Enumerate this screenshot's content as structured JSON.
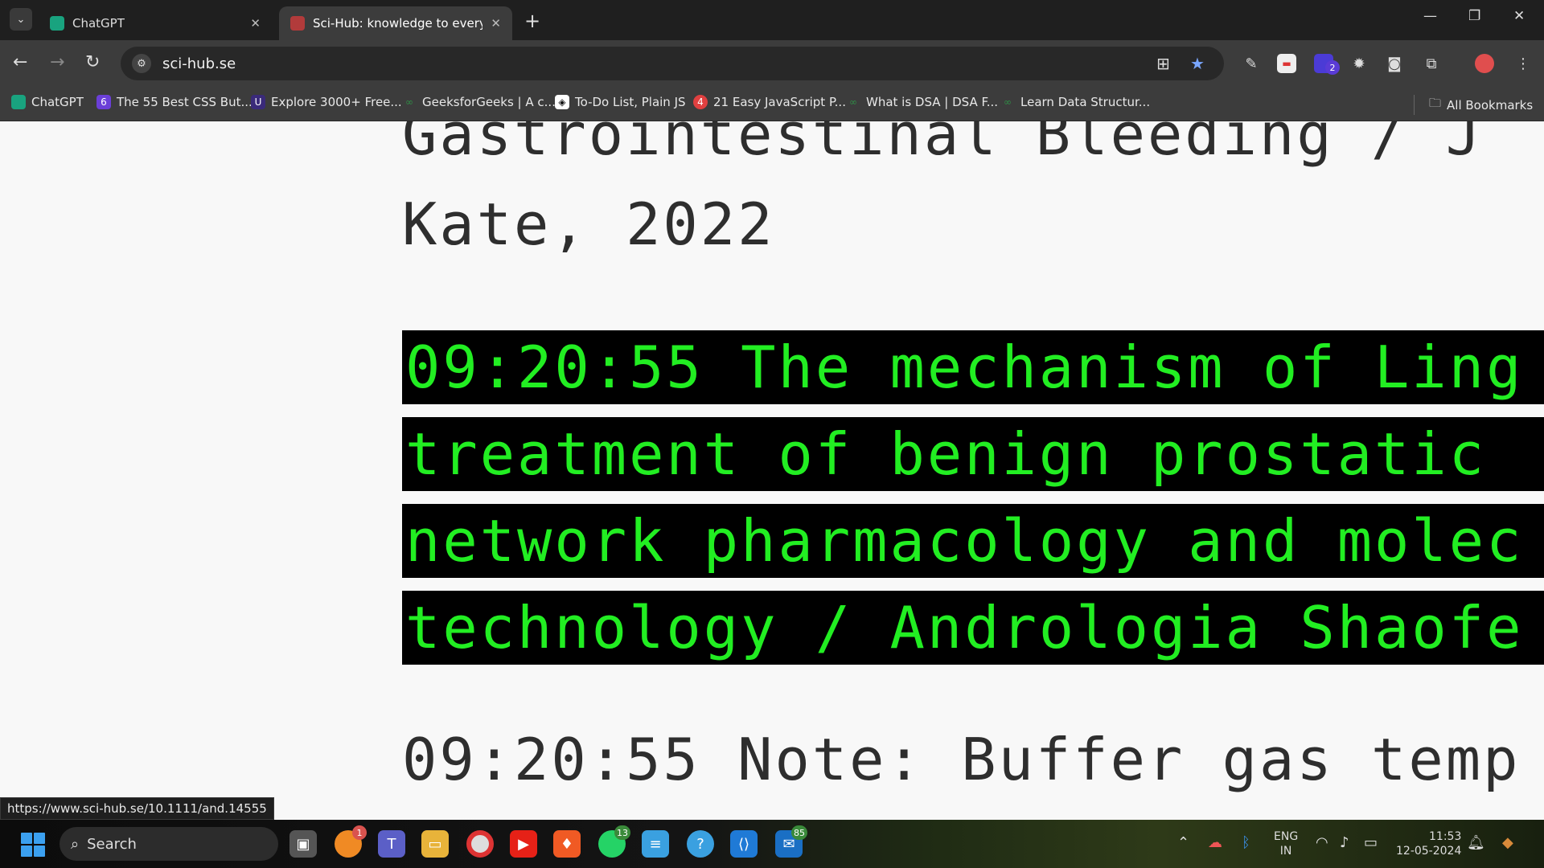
{
  "browser": {
    "tabs": [
      {
        "title": "ChatGPT",
        "icon": "chatgpt-icon",
        "active": false
      },
      {
        "title": "Sci-Hub: knowledge to everyone",
        "icon": "scihub-icon",
        "active": true
      }
    ],
    "address": "sci-hub.se",
    "bookmarks": [
      {
        "label": "ChatGPT",
        "icon": "chatgpt-icon"
      },
      {
        "label": "The 55 Best CSS But...",
        "icon": "six-icon"
      },
      {
        "label": "Explore 3000+ Free...",
        "icon": "ui-icon"
      },
      {
        "label": "GeeksforGeeks | A c...",
        "icon": "gfg-icon"
      },
      {
        "label": "To-Do List, Plain JS",
        "icon": "codepen-icon"
      },
      {
        "label": "21 Easy JavaScript P...",
        "icon": "js-icon"
      },
      {
        "label": "What is DSA | DSA F...",
        "icon": "gfg-icon"
      },
      {
        "label": "Learn Data Structur...",
        "icon": "gfg-icon"
      }
    ],
    "all_bookmarks_label": "All Bookmarks",
    "extension_badge": "2"
  },
  "page": {
    "lines_top": [
      "Gastrointestinal Bleeding / J",
      "Kate, 2022"
    ],
    "highlight_lines": [
      "09:20:55 The mechanism of Ling",
      "treatment of benign prostatic",
      "network pharmacology and molec",
      "technology / Andrologia Shaofe"
    ],
    "bottom_line": "09:20:55 Note: Buffer gas temp",
    "colors": {
      "highlight_bg": "#000000",
      "highlight_text": "#22ee22",
      "text": "#2e2e2e"
    }
  },
  "status_url": "https://www.sci-hub.se/10.1111/and.14555",
  "taskbar": {
    "search_label": "Search",
    "badges": {
      "orange_app": "1",
      "whatsapp": "13",
      "mail": "85"
    },
    "lang_top": "ENG",
    "lang_bottom": "IN",
    "time": "11:53",
    "date": "12-05-2024"
  }
}
